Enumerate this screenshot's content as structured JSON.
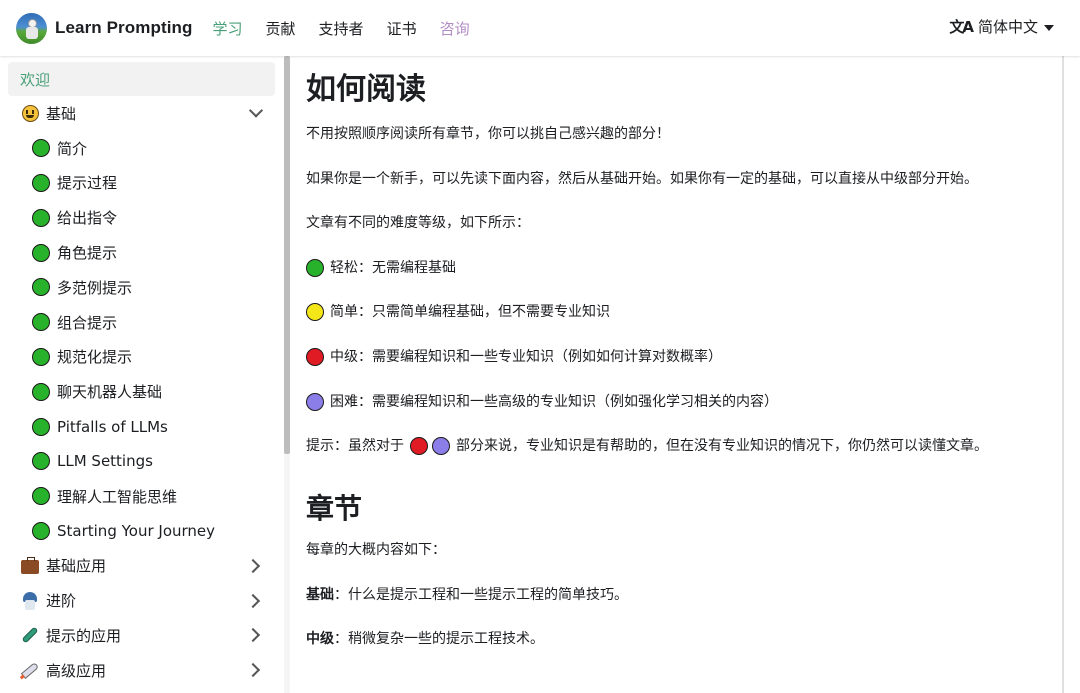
{
  "navbar": {
    "brand": "Learn Prompting",
    "links": [
      {
        "label": "学习",
        "state": "active"
      },
      {
        "label": "贡献",
        "state": "normal"
      },
      {
        "label": "支持者",
        "state": "normal"
      },
      {
        "label": "证书",
        "state": "normal"
      },
      {
        "label": "咨询",
        "state": "highlight"
      }
    ],
    "language": {
      "icon": "translate-icon",
      "label": "简体中文"
    }
  },
  "colors": {
    "accent": "#49a078",
    "consult": "#b38cc4",
    "easy": "#28b12a",
    "simple": "#f5e61a",
    "intermediate": "#e01b24",
    "hard": "#8c7ee8"
  },
  "sidebar": {
    "welcome": "欢迎",
    "basics": {
      "icon": "smiley-icon",
      "label": "基础",
      "expanded": true,
      "items": [
        "简介",
        "提示过程",
        "给出指令",
        "角色提示",
        "多范例提示",
        "组合提示",
        "规范化提示",
        "聊天机器人基础",
        "Pitfalls of LLMs",
        "LLM Settings",
        "理解人工智能思维",
        "Starting Your Journey"
      ]
    },
    "categories": [
      {
        "icon": "briefcase-icon",
        "label": "基础应用"
      },
      {
        "icon": "mage-icon",
        "label": "进阶"
      },
      {
        "icon": "test-tube-icon",
        "label": "提示的应用"
      },
      {
        "icon": "rocket-icon",
        "label": "高级应用"
      }
    ]
  },
  "content": {
    "title": "如何阅读",
    "intro1": "不用按照顺序阅读所有章节，你可以挑自己感兴趣的部分！",
    "intro2": "如果你是一个新手，可以先读下面内容，然后从基础开始。如果你有一定的基础，可以直接从中级部分开始。",
    "intro3": "文章有不同的难度等级，如下所示：",
    "levels": [
      {
        "color": "green",
        "text": "轻松：无需编程基础"
      },
      {
        "color": "yellow",
        "text": "简单：只需简单编程基础，但不需要专业知识"
      },
      {
        "color": "red",
        "text": "中级：需要编程知识和一些专业知识（例如如何计算对数概率）"
      },
      {
        "color": "purple",
        "text": "困难：需要编程知识和一些高级的专业知识（例如强化学习相关的内容）"
      }
    ],
    "tip_prefix": "提示：虽然对于",
    "tip_suffix": "部分来说，专业知识是有帮助的，但在没有专业知识的情况下，你仍然可以读懂文章。",
    "chapters_title": "章节",
    "chapters_intro": "每章的大概内容如下：",
    "chapters": [
      {
        "name": "基础",
        "desc": "：什么是提示工程和一些提示工程的简单技巧。"
      },
      {
        "name": "中级",
        "desc": "：稍微复杂一些的提示工程技术。"
      }
    ]
  }
}
